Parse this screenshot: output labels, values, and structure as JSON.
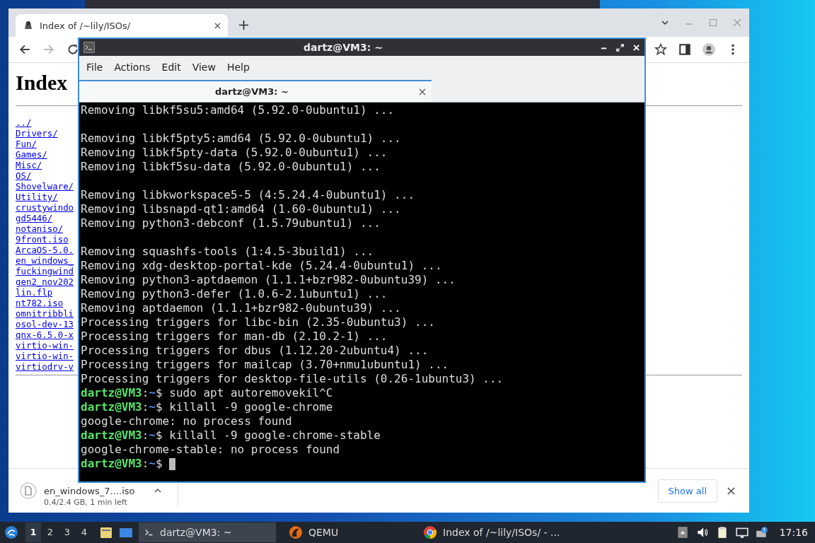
{
  "browser": {
    "tabs": [
      {
        "title": "Index of /~lily/ISOs/",
        "selected": true
      }
    ],
    "page": {
      "heading": "Index",
      "links": [
        "../",
        "Drivers/",
        "Fun/",
        "Games/",
        "Misc/",
        "OS/",
        "Shovelware/",
        "Utility/",
        "crustywindo",
        "gd5446/",
        "notaniso/",
        "9front.iso",
        "ArcaOS-5.0.",
        "en_windows_",
        "fuckingwind",
        "gen2_nov202",
        "lin.flp",
        "nt782.iso",
        "omnitribbli",
        "osol-dev-13",
        "qnx-6.5.0-x",
        "virtio-win-",
        "virtio-win-",
        "virtiodrv-v"
      ]
    },
    "download": {
      "filename": "en_windows_7....iso",
      "status": "0.4/2.4 GB, 1 min left"
    },
    "show_all": "Show all"
  },
  "terminal": {
    "title": "dartz@VM3: ~",
    "menu": [
      "File",
      "Actions",
      "Edit",
      "View",
      "Help"
    ],
    "tabs": [
      {
        "label": "dartz@VM3: ~",
        "selected": true
      }
    ],
    "cursor": true,
    "lines": [
      {
        "kind": "output",
        "segments": [
          {
            "kind": "plain",
            "text": "Removing libkf5su5:amd64 (5.92.0-0ubuntu1) ..."
          }
        ]
      },
      {
        "kind": "blank"
      },
      {
        "kind": "output",
        "segments": [
          {
            "kind": "plain",
            "text": "Removing libkf5pty5:amd64 (5.92.0-0ubuntu1) ..."
          }
        ]
      },
      {
        "kind": "output",
        "segments": [
          {
            "kind": "plain",
            "text": "Removing libkf5pty-data (5.92.0-0ubuntu1) ..."
          }
        ]
      },
      {
        "kind": "output",
        "segments": [
          {
            "kind": "plain",
            "text": "Removing libkf5su-data (5.92.0-0ubuntu1) ..."
          }
        ]
      },
      {
        "kind": "blank"
      },
      {
        "kind": "output",
        "segments": [
          {
            "kind": "plain",
            "text": "Removing libkworkspace5-5 (4:5.24.4-0ubuntu1) ..."
          }
        ]
      },
      {
        "kind": "output",
        "segments": [
          {
            "kind": "plain",
            "text": "Removing libsnapd-qt1:amd64 (1.60-0ubuntu1) ..."
          }
        ]
      },
      {
        "kind": "output",
        "segments": [
          {
            "kind": "plain",
            "text": "Removing python3-debconf (1.5.79ubuntu1) ..."
          }
        ]
      },
      {
        "kind": "blank"
      },
      {
        "kind": "output",
        "segments": [
          {
            "kind": "plain",
            "text": "Removing squashfs-tools (1:4.5-3build1) ..."
          }
        ]
      },
      {
        "kind": "output",
        "segments": [
          {
            "kind": "plain",
            "text": "Removing xdg-desktop-portal-kde (5.24.4-0ubuntu1) ..."
          }
        ]
      },
      {
        "kind": "output",
        "segments": [
          {
            "kind": "plain",
            "text": "Removing python3-aptdaemon (1.1.1+bzr982-0ubuntu39) ..."
          }
        ]
      },
      {
        "kind": "output",
        "segments": [
          {
            "kind": "plain",
            "text": "Removing python3-defer (1.0.6-2.1ubuntu1) ..."
          }
        ]
      },
      {
        "kind": "output",
        "segments": [
          {
            "kind": "plain",
            "text": "Removing aptdaemon (1.1.1+bzr982-0ubuntu39) ..."
          }
        ]
      },
      {
        "kind": "output",
        "segments": [
          {
            "kind": "plain",
            "text": "Processing triggers for libc-bin (2.35-0ubuntu3) ..."
          }
        ]
      },
      {
        "kind": "output",
        "segments": [
          {
            "kind": "plain",
            "text": "Processing triggers for man-db (2.10.2-1) ..."
          }
        ]
      },
      {
        "kind": "output",
        "segments": [
          {
            "kind": "plain",
            "text": "Processing triggers for dbus (1.12.20-2ubuntu4) ..."
          }
        ]
      },
      {
        "kind": "output",
        "segments": [
          {
            "kind": "plain",
            "text": "Processing triggers for mailcap (3.70+nmu1ubuntu1) ..."
          }
        ]
      },
      {
        "kind": "output",
        "segments": [
          {
            "kind": "plain",
            "text": "Processing triggers for desktop-file-utils (0.26-1ubuntu3) ..."
          }
        ]
      },
      {
        "kind": "prompt",
        "segments": [
          {
            "kind": "user",
            "text": "dartz@VM3"
          },
          {
            "kind": "plain",
            "text": ":"
          },
          {
            "kind": "path",
            "text": "~"
          },
          {
            "kind": "plain",
            "text": "$ sudo apt autoremovekil^C"
          }
        ]
      },
      {
        "kind": "prompt",
        "segments": [
          {
            "kind": "user",
            "text": "dartz@VM3"
          },
          {
            "kind": "plain",
            "text": ":"
          },
          {
            "kind": "path",
            "text": "~"
          },
          {
            "kind": "plain",
            "text": "$ killall -9 google-chrome"
          }
        ]
      },
      {
        "kind": "output",
        "segments": [
          {
            "kind": "plain",
            "text": "google-chrome: no process found"
          }
        ]
      },
      {
        "kind": "prompt",
        "segments": [
          {
            "kind": "user",
            "text": "dartz@VM3"
          },
          {
            "kind": "plain",
            "text": ":"
          },
          {
            "kind": "path",
            "text": "~"
          },
          {
            "kind": "plain",
            "text": "$ killall -9 google-chrome-stable"
          }
        ]
      },
      {
        "kind": "output",
        "segments": [
          {
            "kind": "plain",
            "text": "google-chrome-stable: no process found"
          }
        ]
      },
      {
        "kind": "prompt",
        "segments": [
          {
            "kind": "user",
            "text": "dartz@VM3"
          },
          {
            "kind": "plain",
            "text": ":"
          },
          {
            "kind": "path",
            "text": "~"
          },
          {
            "kind": "plain",
            "text": "$"
          }
        ]
      }
    ]
  },
  "taskbar": {
    "workspaces": [
      {
        "label": "1",
        "selected": true
      },
      {
        "label": "2",
        "selected": false
      },
      {
        "label": "3",
        "selected": false
      },
      {
        "label": "4",
        "selected": false
      }
    ],
    "tasks": [
      {
        "kind": "terminal",
        "label": "dartz@VM3: ~",
        "selected": true
      },
      {
        "kind": "qemu",
        "label": "QEMU",
        "selected": false
      },
      {
        "kind": "browser",
        "label": "Index of /~lily/ISOs/ - ...",
        "selected": false
      }
    ],
    "clock": "17:16"
  }
}
